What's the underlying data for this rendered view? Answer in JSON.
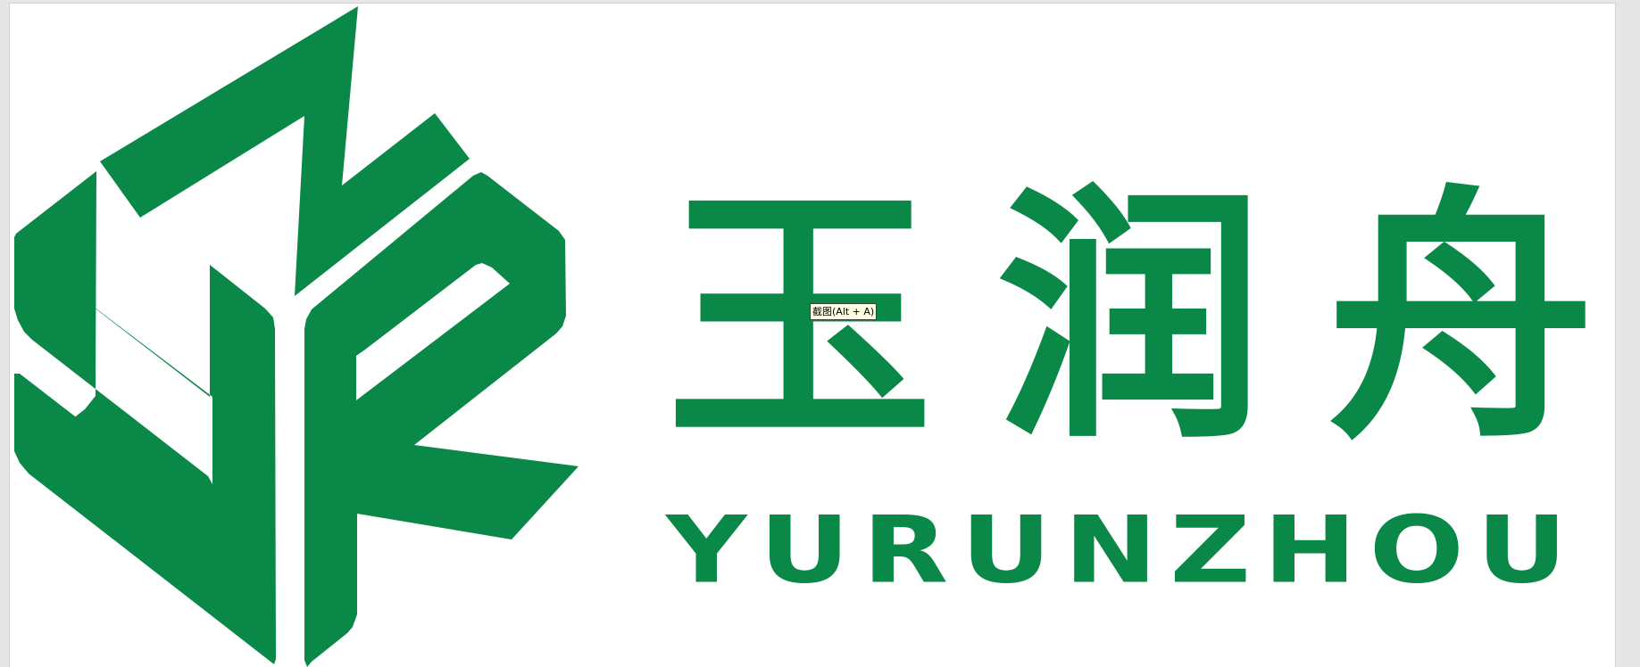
{
  "brand": {
    "name_cn": "玉润舟",
    "name_en": "YURUNZHOU",
    "color": "#0a8847"
  },
  "tooltip": {
    "text": "截图(Alt + A)"
  },
  "logo": {
    "icon": "jr-monogram-logo-icon"
  }
}
